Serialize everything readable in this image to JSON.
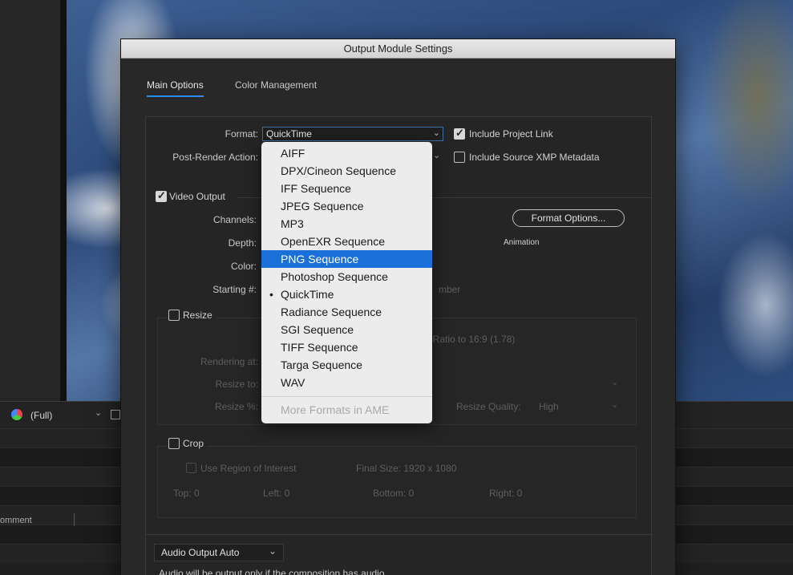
{
  "background_app": {
    "viewer_magnification": "(Full)",
    "panel_label": "omment"
  },
  "dialog": {
    "title": "Output Module Settings",
    "tabs": [
      {
        "label": "Main Options",
        "active": true
      },
      {
        "label": "Color Management",
        "active": false
      }
    ],
    "format": {
      "label": "Format:",
      "value": "QuickTime",
      "include_project_link": {
        "label": "Include Project Link",
        "checked": true
      }
    },
    "post_render": {
      "label": "Post-Render Action:",
      "include_xmp": {
        "label": "Include Source XMP Metadata",
        "checked": false
      }
    },
    "video_output": {
      "label": "Video Output",
      "checked": true,
      "channels_label": "Channels:",
      "depth_label": "Depth:",
      "color_label": "Color:",
      "starting_label": "Starting #:",
      "starting_suffix": "mber",
      "format_options_button": "Format Options...",
      "codec_label": "Animation"
    },
    "resize": {
      "label": "Resize",
      "checked": false,
      "aspect_text": "ct Ratio to 16:9 (1.78)",
      "rendering_at_label": "Rendering at:",
      "resize_to_label": "Resize to:",
      "resize_pct_label": "Resize %:",
      "resize_quality_label": "Resize Quality:",
      "resize_quality_value": "High"
    },
    "crop": {
      "label": "Crop",
      "checked": false,
      "use_roi_label": "Use Region of Interest",
      "final_size": "Final Size: 1920 x 1080",
      "top": "Top:  0",
      "left": "Left:  0",
      "bottom": "Bottom:  0",
      "right": "Right:  0"
    },
    "audio": {
      "select_value": "Audio Output Auto",
      "note": "Audio will be output only if the composition has audio."
    }
  },
  "format_menu": {
    "items": [
      {
        "label": "AIFF"
      },
      {
        "label": "DPX/Cineon Sequence"
      },
      {
        "label": "IFF Sequence"
      },
      {
        "label": "JPEG Sequence"
      },
      {
        "label": "MP3"
      },
      {
        "label": "OpenEXR Sequence"
      },
      {
        "label": "PNG Sequence",
        "highlighted": true
      },
      {
        "label": "Photoshop Sequence"
      },
      {
        "label": "QuickTime",
        "selected": true
      },
      {
        "label": "Radiance Sequence"
      },
      {
        "label": "SGI Sequence"
      },
      {
        "label": "TIFF Sequence"
      },
      {
        "label": "Targa Sequence"
      },
      {
        "label": "WAV"
      }
    ],
    "more_formats": "More Formats in AME"
  },
  "colors": {
    "accent_blue": "#1b6fd8",
    "tab_underline": "#2d8ceb",
    "dialog_bg": "#282828"
  }
}
